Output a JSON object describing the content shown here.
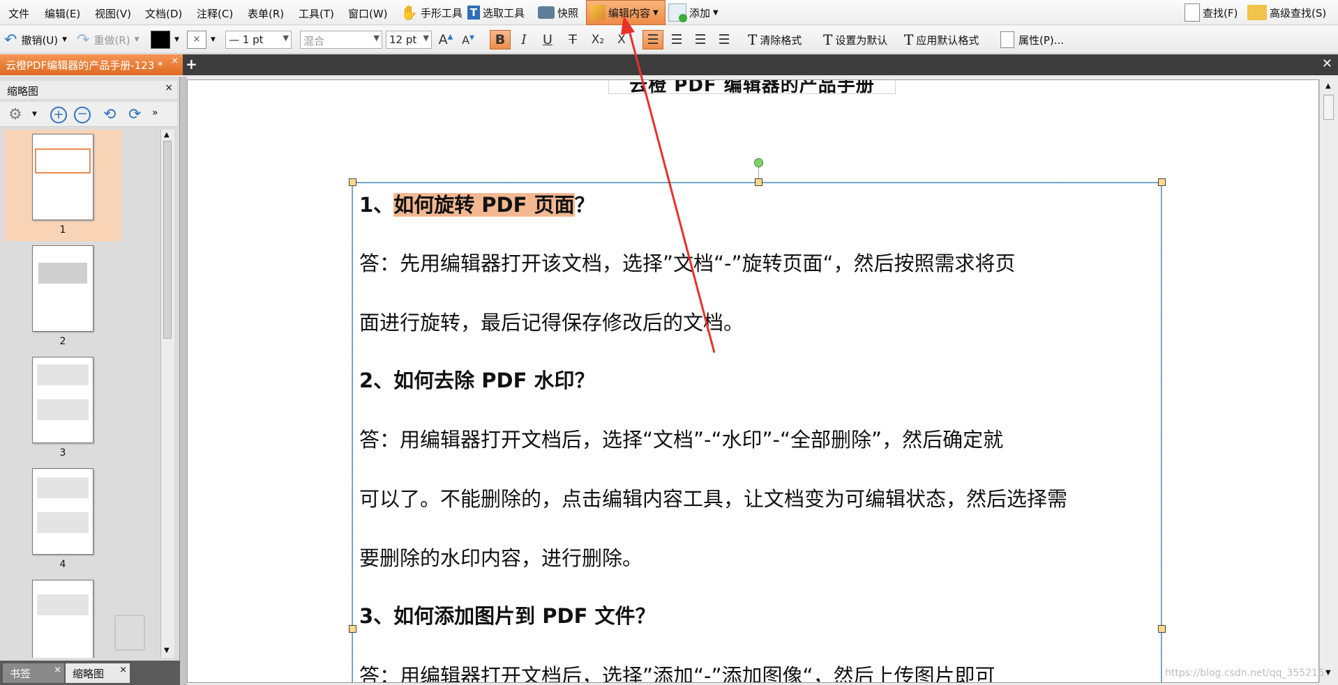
{
  "menubar": {
    "items": [
      "文件",
      "编辑(E)",
      "视图(V)",
      "文档(D)",
      "注释(C)",
      "表单(R)",
      "工具(T)",
      "窗口(W)"
    ],
    "hand_tool": "手形工具",
    "select_tool": "选取工具",
    "snapshot": "快照",
    "edit_content": "编辑内容",
    "add": "添加",
    "find": "查找(F)",
    "adv_find": "高级查找(S)"
  },
  "formatbar": {
    "undo": "撤销(U)",
    "redo": "重做(R)",
    "line_width": "— 1 pt",
    "blend": "混合",
    "font_size": "12 pt",
    "bold": "B",
    "italic": "I",
    "underline": "U",
    "strike": "T",
    "subscript": "X₂",
    "superscript": "X",
    "clear_format": "清除格式",
    "set_default": "设置为默认",
    "apply_default": "应用默认格式",
    "properties": "属性(P)..."
  },
  "tabs": {
    "document": "云橙PDF编辑器的产品手册-123 *",
    "close": "×",
    "new": "+"
  },
  "sidebar": {
    "title": "缩略图",
    "close": "×",
    "pages": [
      "1",
      "2",
      "3",
      "4",
      ""
    ],
    "bottom_tabs": [
      "书签",
      "缩略图"
    ]
  },
  "document": {
    "title": "云橙 PDF 编辑器的产品手册",
    "q1_num": "1、",
    "q1_text": "如何旋转 PDF 页面",
    "q1_mark": "？",
    "a1_line1": "答：先用编辑器打开该文档，选择”文档“-”旋转页面“，然后按照需求将页",
    "a1_line2": "面进行旋转，最后记得保存修改后的文档。",
    "q2": "2、如何去除 PDF 水印？",
    "a2_line1": "答：用编辑器打开文档后，选择“文档”-“水印”-“全部删除”，然后确定就",
    "a2_line2": "可以了。不能删除的，点击编辑内容工具，让文档变为可编辑状态，然后选择需",
    "a2_line3": "要删除的水印内容，进行删除。",
    "q3": "3、如何添加图片到 PDF 文件？",
    "a3_line1": "答：用编辑器打开文档后，选择”添加“-”添加图像“，然后上传图片即可"
  },
  "watermark": "https://blog.csdn.net/qq_355216",
  "colors": {
    "accent": "#ef8c4b",
    "highlight": "#f3b892",
    "selection_border": "#4da3e0",
    "arrow": "#e8302a"
  }
}
